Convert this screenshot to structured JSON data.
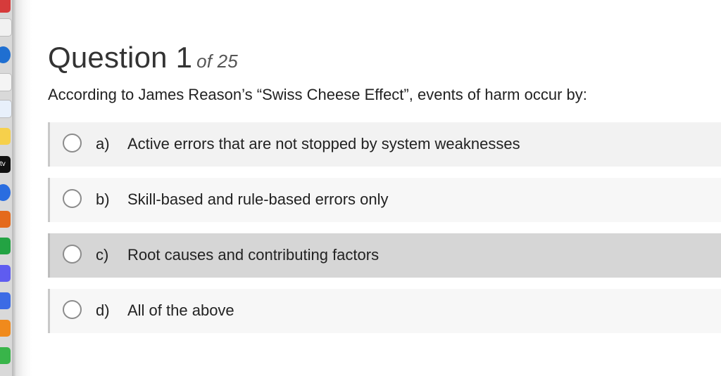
{
  "dock": {
    "icons": [
      {
        "name": "app-icon-1",
        "color": "#d63b3b"
      },
      {
        "name": "calendar-icon",
        "color": "#f1f1f1"
      },
      {
        "name": "safari-compass-icon",
        "color": "#1f6fd1"
      },
      {
        "name": "notes-icon",
        "color": "#f4f4f4"
      },
      {
        "name": "reminders-icon",
        "color": "#e8f0fb"
      },
      {
        "name": "freeform-icon",
        "color": "#f6d04b"
      },
      {
        "name": "apple-tv-icon",
        "color": "#111111"
      },
      {
        "name": "chrome-icon",
        "color": "#2a6de0"
      },
      {
        "name": "pages-icon",
        "color": "#e46a1c"
      },
      {
        "name": "numbers-icon",
        "color": "#23a343"
      },
      {
        "name": "music-icon",
        "color": "#5f5cf0"
      },
      {
        "name": "xcode-icon",
        "color": "#3c6be5"
      },
      {
        "name": "keynote-icon",
        "color": "#f08a1c"
      },
      {
        "name": "charts-app-icon",
        "color": "#39b54a"
      }
    ],
    "tv_label": "tv"
  },
  "question": {
    "title": "Question 1",
    "of_label": "of 25",
    "prompt": "According to James Reason’s “Swiss Cheese Effect”, events of harm occur by:"
  },
  "choices": [
    {
      "letter": "a)",
      "text": "Active errors that are not stopped by system weaknesses",
      "selected": false
    },
    {
      "letter": "b)",
      "text": "Skill-based and rule-based errors only",
      "selected": false
    },
    {
      "letter": "c)",
      "text": "Root causes and contributing factors",
      "selected": false
    },
    {
      "letter": "d)",
      "text": "All of the above",
      "selected": false
    }
  ]
}
